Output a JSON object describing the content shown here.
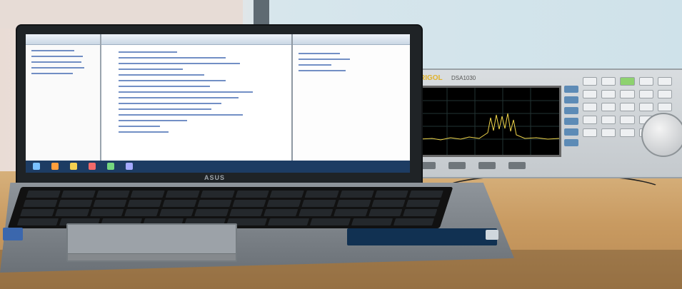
{
  "scene": {
    "laptop_brand": "ASUS",
    "instrument_brand": "RIGOL",
    "instrument_model": "DSA1030"
  }
}
